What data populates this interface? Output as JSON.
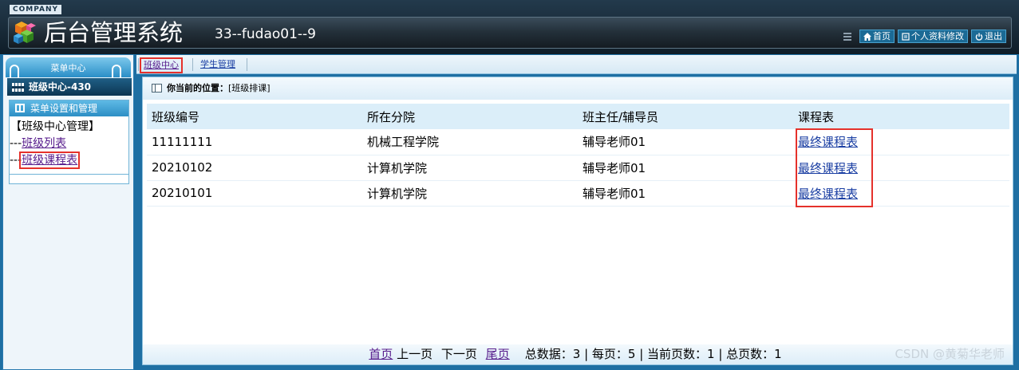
{
  "header": {
    "company": "COMPANY",
    "title": "后台管理系统",
    "user": "33--fudao01--9",
    "links": [
      {
        "label": "首页",
        "icon": "home-icon"
      },
      {
        "label": "个人资料修改",
        "icon": "profile-icon"
      },
      {
        "label": "退出",
        "icon": "power-icon"
      }
    ]
  },
  "sidebar": {
    "menu_title": "菜单中心",
    "center_label": "班级中心-430",
    "settings_title": "菜单设置和管理",
    "group_label": "【班级中心管理】",
    "items": [
      {
        "prefix": "---",
        "label": "班级列表"
      },
      {
        "prefix": "---",
        "label": "班级课程表"
      }
    ]
  },
  "tabs": [
    {
      "label": "班级中心"
    },
    {
      "label": "学生管理"
    }
  ],
  "breadcrumb": {
    "prefix": "你当前的位置：",
    "location": "[班级排课]"
  },
  "table": {
    "columns": [
      "班级编号",
      "所在分院",
      "班主任/辅导员",
      "课程表"
    ],
    "rows": [
      [
        "11111111",
        "机械工程学院",
        "辅导老师01",
        "最终课程表"
      ],
      [
        "20210102",
        "计算机学院",
        "辅导老师01",
        "最终课程表"
      ],
      [
        "20210101",
        "计算机学院",
        "辅导老师01",
        "最终课程表"
      ]
    ]
  },
  "pager": {
    "first": "首页",
    "prev": "上一页",
    "next": "下一页",
    "last": "尾页",
    "summary": "总数据：3 | 每页：5 | 当前页数：1 | 总页数：1"
  },
  "watermark": "CSDN @黄菊华老师",
  "colors": {
    "header_bg": "#1b2a35",
    "accent_blue": "#2a8ec7",
    "highlight_red": "#e5312b",
    "link_blue": "#1b3fa3",
    "visited_purple": "#551a8b"
  }
}
